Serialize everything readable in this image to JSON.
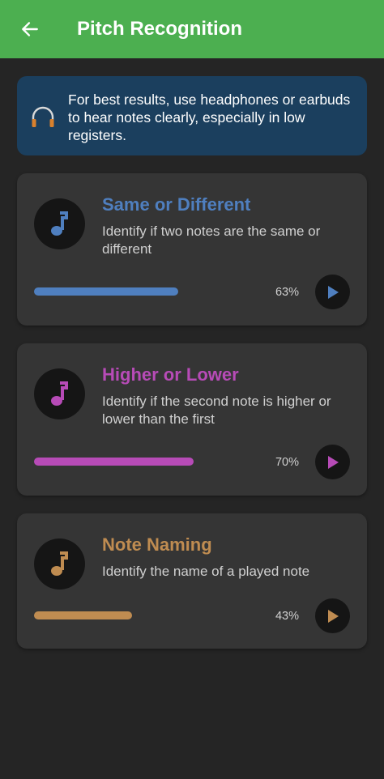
{
  "appbar": {
    "title": "Pitch Recognition"
  },
  "banner": {
    "text": "For best results, use headphones or earbuds to hear notes clearly, especially in low registers."
  },
  "exercises": [
    {
      "title": "Same or Different",
      "description": "Identify if two notes are the same or different",
      "progress_label": "63%",
      "progress": 0.63,
      "color": "#4f7fbf"
    },
    {
      "title": "Higher or Lower",
      "description": "Identify if the second note is higher or lower than the first",
      "progress_label": "70%",
      "progress": 0.7,
      "color": "#b74bb7"
    },
    {
      "title": "Note Naming",
      "description": "Identify the name of a played note",
      "progress_label": "43%",
      "progress": 0.43,
      "color": "#bf8c51"
    }
  ],
  "colors": {
    "appbar": "#4caf50",
    "background": "#252525",
    "banner": "#1b3f5e",
    "card": "#353535",
    "headphones": "#d9812d"
  },
  "icons": {
    "back": "arrow-left-icon",
    "banner": "headphones-icon",
    "card": "music-note-icon",
    "play": "play-icon"
  }
}
